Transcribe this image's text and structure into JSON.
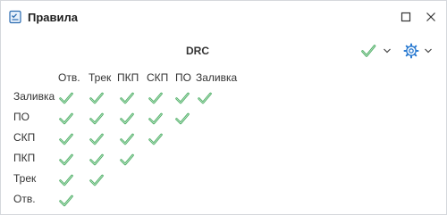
{
  "window": {
    "title": "Правила",
    "app_icon": "rules-window-icon",
    "maximize_icon": "maximize-icon",
    "close_icon": "close-icon"
  },
  "header": {
    "title": "DRC",
    "tools": [
      {
        "icon": "check-icon",
        "has_dropdown": true
      },
      {
        "icon": "gear-icon",
        "has_dropdown": true
      }
    ]
  },
  "matrix": {
    "columns": [
      "Отв.",
      "Трек",
      "ПКП",
      "СКП",
      "ПО",
      "Заливка"
    ],
    "rows": [
      {
        "label": "Заливка",
        "checked": [
          true,
          true,
          true,
          true,
          true,
          true
        ]
      },
      {
        "label": "ПО",
        "checked": [
          true,
          true,
          true,
          true,
          true
        ]
      },
      {
        "label": "СКП",
        "checked": [
          true,
          true,
          true,
          true
        ]
      },
      {
        "label": "ПКП",
        "checked": [
          true,
          true,
          true
        ]
      },
      {
        "label": "Трек",
        "checked": [
          true,
          true
        ]
      },
      {
        "label": "Отв.",
        "checked": [
          true
        ]
      }
    ],
    "check_color": "#4fae66"
  }
}
